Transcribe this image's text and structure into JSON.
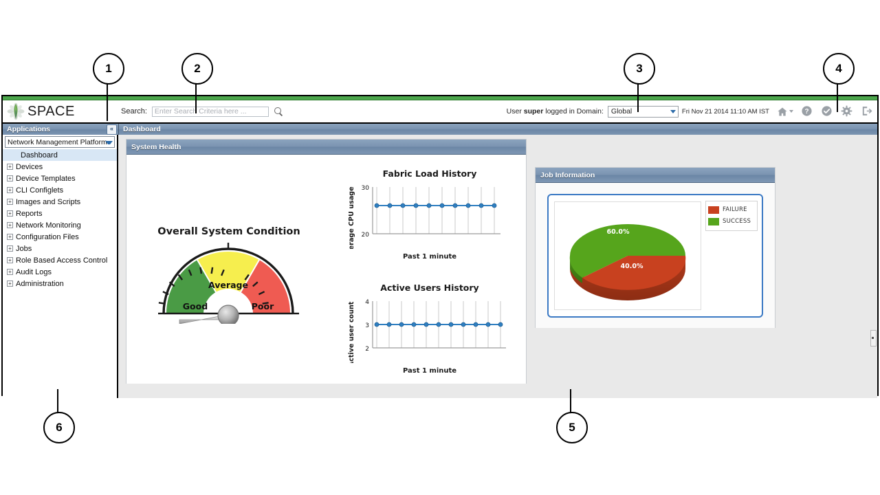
{
  "callouts": [
    {
      "n": "1"
    },
    {
      "n": "2"
    },
    {
      "n": "3"
    },
    {
      "n": "4"
    },
    {
      "n": "5"
    },
    {
      "n": "6"
    }
  ],
  "header": {
    "logo_text": "SPACE",
    "search_label": "Search:",
    "search_value": "",
    "search_placeholder": "Enter Search Criteria here ...",
    "user_prefix": "User ",
    "user_name": "super",
    "user_suffix": " logged in Domain:",
    "domain_value": "Global",
    "datetime": "Fri Nov 21 2014 11:10 AM IST",
    "icons": [
      "home-icon",
      "help-icon",
      "check-circle-icon",
      "gear-icon",
      "logout-icon"
    ]
  },
  "strips": {
    "applications_label": "Applications",
    "collapse_label": "«",
    "dashboard_label": "Dashboard"
  },
  "sidebar": {
    "platform_value": "Network Management Platform",
    "items": [
      {
        "label": "Dashboard",
        "expandable": false,
        "selected": true
      },
      {
        "label": "Devices",
        "expandable": true,
        "selected": false
      },
      {
        "label": "Device Templates",
        "expandable": true,
        "selected": false
      },
      {
        "label": "CLI Configlets",
        "expandable": true,
        "selected": false
      },
      {
        "label": "Images and Scripts",
        "expandable": true,
        "selected": false
      },
      {
        "label": "Reports",
        "expandable": true,
        "selected": false
      },
      {
        "label": "Network Monitoring",
        "expandable": true,
        "selected": false
      },
      {
        "label": "Configuration Files",
        "expandable": true,
        "selected": false
      },
      {
        "label": "Jobs",
        "expandable": true,
        "selected": false
      },
      {
        "label": "Role Based Access Control",
        "expandable": true,
        "selected": false
      },
      {
        "label": "Audit Logs",
        "expandable": true,
        "selected": false
      },
      {
        "label": "Administration",
        "expandable": true,
        "selected": false
      }
    ],
    "expand_glyph": "+"
  },
  "panels": {
    "system_health_title": "System Health",
    "job_information_title": "Job Information"
  },
  "gauge": {
    "title": "Overall System Condition",
    "segments": [
      {
        "label": "Good",
        "color": "#4a9b45"
      },
      {
        "label": "Average",
        "color": "#f6ee4e"
      },
      {
        "label": "Poor",
        "color": "#ef5b52"
      }
    ],
    "needle_value": "Good"
  },
  "chart_data": [
    {
      "type": "line",
      "title": "Fabric Load History",
      "xlabel": "Past 1 minute",
      "ylabel": "Average CPU usage",
      "ylim": [
        20,
        30
      ],
      "yticks": [
        20,
        30
      ],
      "ytick_labels": [
        "20",
        "30"
      ],
      "x": [
        1,
        2,
        3,
        4,
        5,
        6,
        7,
        8,
        9,
        10
      ],
      "values": [
        26,
        26,
        26,
        26,
        26,
        26,
        26,
        26,
        26,
        26
      ],
      "series_color": "#2f7fc1",
      "grid": true,
      "legend": "none"
    },
    {
      "type": "line",
      "title": "Active Users History",
      "xlabel": "Past 1 minute",
      "ylabel": "Active user count",
      "ylim": [
        2,
        4
      ],
      "yticks": [
        2,
        3,
        4
      ],
      "ytick_labels": [
        "2",
        "3",
        "4"
      ],
      "x": [
        1,
        2,
        3,
        4,
        5,
        6,
        7,
        8,
        9,
        10,
        11
      ],
      "values": [
        3,
        3,
        3,
        3,
        3,
        3,
        3,
        3,
        3,
        3,
        3
      ],
      "series_color": "#2f7fc1",
      "grid": true,
      "legend": "none"
    },
    {
      "type": "pie",
      "title": "",
      "labels": [
        "FAILURE",
        "SUCCESS"
      ],
      "values": [
        40.0,
        60.0
      ],
      "value_labels": [
        "40.0%",
        "60.0%"
      ],
      "colors": [
        "#c8411f",
        "#56a51c"
      ],
      "legend": "right",
      "three_d": true
    }
  ]
}
